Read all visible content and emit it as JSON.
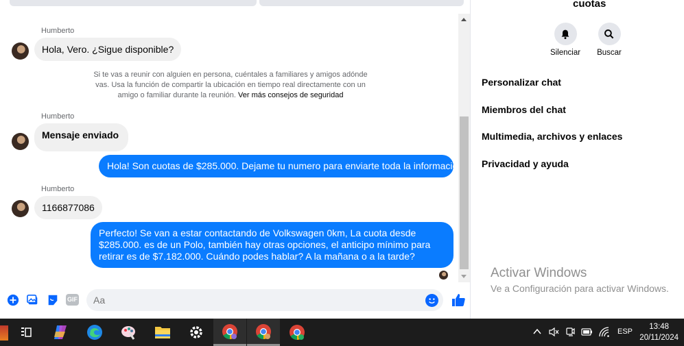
{
  "chat": {
    "messages": [
      {
        "sender": "Humberto",
        "text": "Hola, Vero. ¿Sigue disponible?"
      },
      {
        "sender": "Humberto",
        "text": "Mensaje enviado"
      },
      {
        "text": "Hola! Son cuotas de $285.000. Dejame tu numero para enviarte toda la informacion"
      },
      {
        "sender": "Humberto",
        "text": "1166877086"
      },
      {
        "text": "Perfecto!  Se van a estar contactando de Volkswagen 0km, La cuota desde $285.000. es de un Polo, también hay otras opciones, el anticipo mínimo para retirar es de $7.182.000. Cuándo podes hablar? A la mañana o a la tarde?"
      }
    ],
    "safety_notice": "Si te vas a reunir con alguien en persona, cuéntales a familiares y amigos adónde vas. Usa la función de compartir la ubicación en tiempo real directamente con un amigo o familiar durante la reunión.",
    "safety_link": "Ver más consejos de seguridad"
  },
  "composer": {
    "placeholder": "Aa",
    "gif_label": "GIF"
  },
  "panel": {
    "title": "cuotas",
    "actions": [
      "Silenciar",
      "Buscar"
    ],
    "menu": [
      "Personalizar chat",
      "Miembros del chat",
      "Multimedia, archivos y enlaces",
      "Privacidad y ayuda"
    ]
  },
  "watermark": {
    "title": "Activar Windows",
    "subtitle": "Ve a Configuración para activar Windows."
  },
  "taskbar": {
    "language": "ESP",
    "time": "13:48",
    "date": "20/11/2024",
    "apps": [
      "task-view",
      "copilot",
      "edge",
      "paint",
      "file-explorer",
      "settings",
      "chrome",
      "chrome-profile",
      "chrome-profile-2"
    ]
  },
  "colors": {
    "accent": "#0866ff",
    "outgoing_bubble": "#0a7cff",
    "incoming_bubble": "#f0f0f0",
    "taskbar": "#1c1c1c"
  }
}
